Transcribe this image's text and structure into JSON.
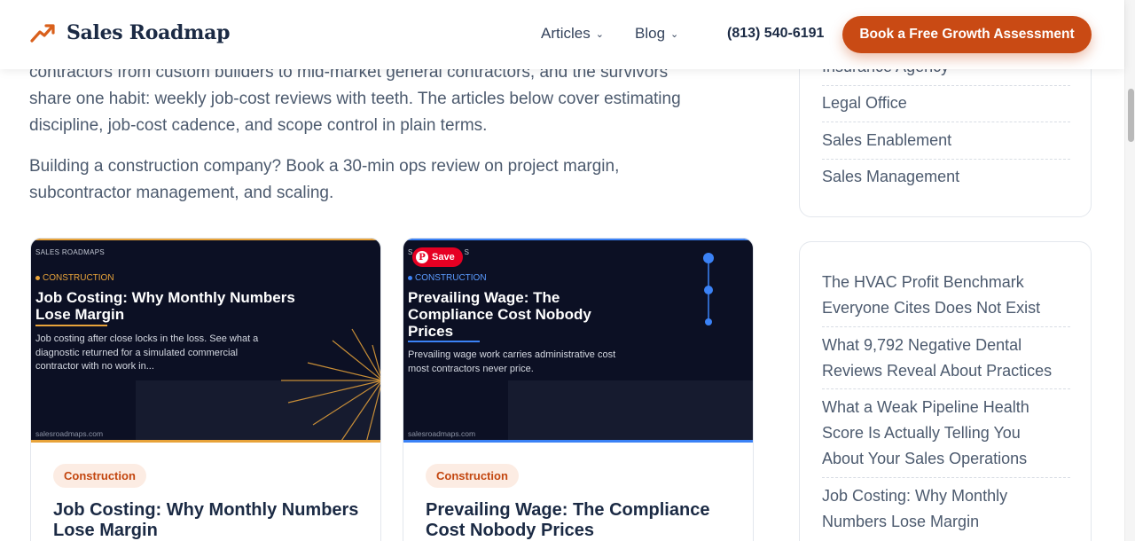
{
  "header": {
    "brand": "Sales Roadmap",
    "nav": [
      {
        "label": "Articles"
      },
      {
        "label": "Blog"
      }
    ],
    "phone": "(813) 540-6191",
    "cta": "Book a Free Growth Assessment"
  },
  "intro": {
    "paragraph1_lines": [
      "contractors from custom builders to mid-market general contractors, and the survivors",
      "share one habit: weekly job-cost reviews with teeth. The articles below cover estimating",
      "discipline, job-cost cadence, and scope control in plain terms."
    ],
    "paragraph2_lines": [
      "Building a construction company? Book a 30-min ops review on project margin,",
      "subcontractor management, and scaling."
    ]
  },
  "cards": [
    {
      "image_brand": "SALES ROADMAPS",
      "image_category": "CONSTRUCTION",
      "image_title": "Job Costing: Why Monthly Numbers Lose Margin",
      "image_desc": "Job costing after close locks in the loss. See what a diagnostic returned for a simulated commercial contractor with no work in...",
      "image_url": "salesroadmaps.com",
      "accent": "#e8a33a",
      "tag": "Construction",
      "title": "Job Costing: Why Monthly Numbers Lose Margin"
    },
    {
      "image_brand": "S",
      "image_brand_tail": "S",
      "image_category": "CONSTRUCTION",
      "image_title": "Prevailing Wage: The Compliance Cost Nobody Prices",
      "image_desc": "Prevailing wage work carries administrative cost most contractors never price.",
      "image_url": "salesroadmaps.com",
      "accent": "#3b82f6",
      "tag": "Construction",
      "title": "Prevailing Wage: The Compliance Cost Nobody Prices",
      "save_label": "Save"
    }
  ],
  "sidebar": {
    "categories": [
      "Insurance Agency",
      "Legal Office",
      "Sales Enablement",
      "Sales Management"
    ],
    "recent": [
      [
        "The HVAC Profit Benchmark",
        "Everyone Cites Does Not Exist"
      ],
      [
        "What 9,792 Negative Dental",
        "Reviews Reveal About Practices"
      ],
      [
        "What a Weak Pipeline Health",
        "Score Is Actually Telling You",
        "About Your Sales Operations"
      ],
      [
        "Job Costing: Why Monthly",
        "Numbers Lose Margin"
      ]
    ]
  },
  "colors": {
    "brand_orange": "#c94a14",
    "navy": "#1b2a44",
    "card_dark": "#0c1024"
  }
}
